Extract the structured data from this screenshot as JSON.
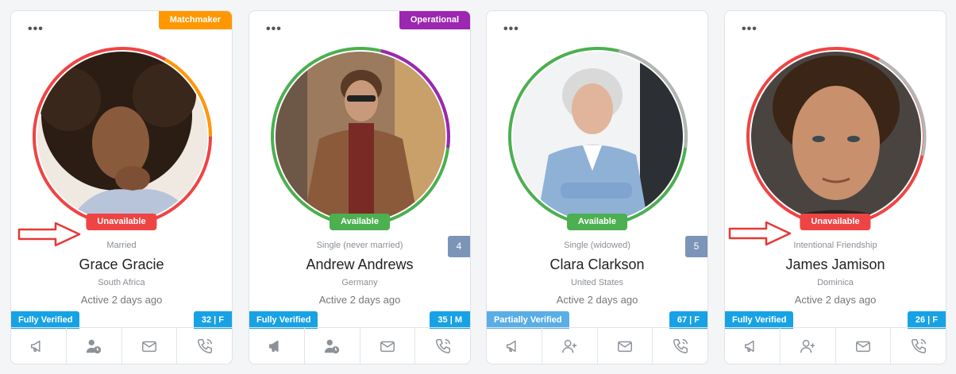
{
  "colors": {
    "red": "#ef4444",
    "green": "#4caf50",
    "orange": "#ff9800",
    "purple": "#9c27b0",
    "gray": "#b5b5b5",
    "verified": "#17a2e6",
    "partial": "#5aaee6",
    "arrow": "#e53935"
  },
  "cards": [
    {
      "ribbon": "Matchmaker",
      "menu": "•••",
      "availability": "Unavailable",
      "relationship": "Married",
      "name": "Grace Gracie",
      "country": "South Africa",
      "active": "Active 2 days ago",
      "count": "",
      "verification": "Fully Verified",
      "age_gender": "32 | F"
    },
    {
      "ribbon": "Operational",
      "menu": "•••",
      "availability": "Available",
      "relationship": "Single (never married)",
      "name": "Andrew Andrews",
      "country": "Germany",
      "active": "Active 2 days ago",
      "count": "4",
      "verification": "Fully Verified",
      "age_gender": "35 | M"
    },
    {
      "ribbon": "",
      "menu": "•••",
      "availability": "Available",
      "relationship": "Single (widowed)",
      "name": "Clara Clarkson",
      "country": "United States",
      "active": "Active 2 days ago",
      "count": "5",
      "verification": "Partially Verified",
      "age_gender": "67 | F"
    },
    {
      "ribbon": "",
      "menu": "•••",
      "availability": "Unavailable",
      "relationship": "Intentional Friendship",
      "name": "James Jamison",
      "country": "Dominica",
      "active": "Active 2 days ago",
      "count": "",
      "verification": "Fully Verified",
      "age_gender": "26 | F"
    }
  ],
  "action_icons": [
    "megaphone-icon",
    "user-clock-icon",
    "envelope-icon",
    "phone-call-icon"
  ]
}
